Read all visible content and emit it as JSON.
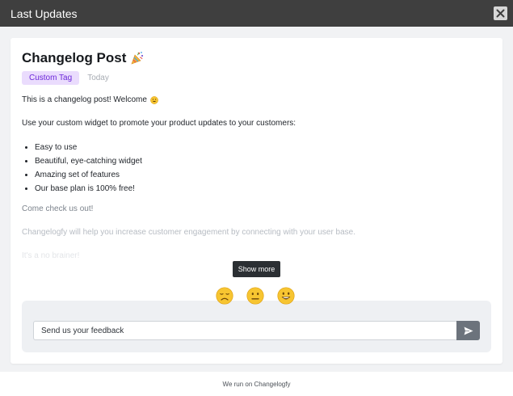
{
  "header": {
    "title": "Last Updates"
  },
  "post": {
    "title": "Changelog Post",
    "tag": "Custom Tag",
    "date": "Today",
    "intro": "This is a changelog post! Welcome",
    "paragraph": "Use your custom widget to promote your product updates to your customers:",
    "features": [
      "Easy to use",
      "Beautiful, eye-catching widget",
      "Amazing set of features",
      "Our base plan is 100% free!"
    ],
    "cta": "Come check us out!",
    "description": "Changelogfy will help you increase customer engagement by connecting with your user base.",
    "closing": "It's a no brainer!"
  },
  "show_more": {
    "label": "Show more"
  },
  "feedback": {
    "reactions": [
      "sad-face-icon",
      "neutral-face-icon",
      "happy-face-icon"
    ],
    "placeholder": "Send us your feedback"
  },
  "footer": {
    "text": "We run on Changelogfy"
  },
  "colors": {
    "header_bg": "#3f3f3f",
    "tag_bg": "#eadcfd",
    "tag_text": "#6d28d9",
    "send_button": "#6c737c",
    "emoji_yellow": "#f7c531"
  }
}
